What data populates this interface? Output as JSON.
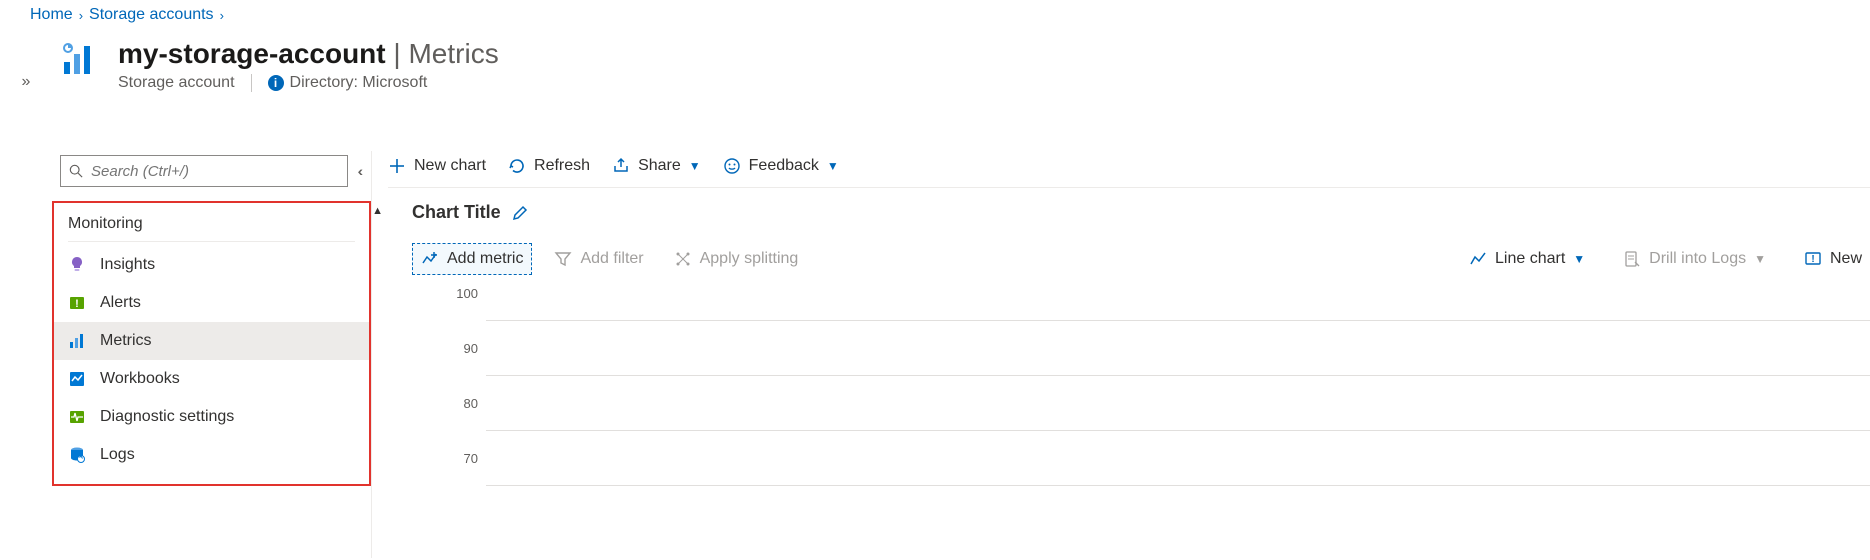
{
  "breadcrumb": {
    "home": "Home",
    "storage_accounts": "Storage accounts"
  },
  "header": {
    "resource_name": "my-storage-account",
    "separator": " | ",
    "section": "Metrics",
    "resource_type": "Storage account",
    "directory_label": "Directory: Microsoft"
  },
  "search": {
    "placeholder": "Search (Ctrl+/)"
  },
  "sidebar": {
    "section_title": "Monitoring",
    "items": [
      {
        "label": "Insights"
      },
      {
        "label": "Alerts"
      },
      {
        "label": "Metrics"
      },
      {
        "label": "Workbooks"
      },
      {
        "label": "Diagnostic settings"
      },
      {
        "label": "Logs"
      }
    ]
  },
  "toolbar": {
    "new_chart": "New chart",
    "refresh": "Refresh",
    "share": "Share",
    "feedback": "Feedback"
  },
  "chart": {
    "title": "Chart Title",
    "add_metric": "Add metric",
    "add_filter": "Add filter",
    "apply_splitting": "Apply splitting",
    "chart_type": "Line chart",
    "drill_logs": "Drill into Logs",
    "new_alert": "New"
  },
  "chart_data": {
    "type": "line",
    "title": "Chart Title",
    "series": [],
    "ylim": [
      70,
      100
    ],
    "yticks": [
      100,
      90,
      80,
      70
    ],
    "xlabel": "",
    "ylabel": ""
  }
}
